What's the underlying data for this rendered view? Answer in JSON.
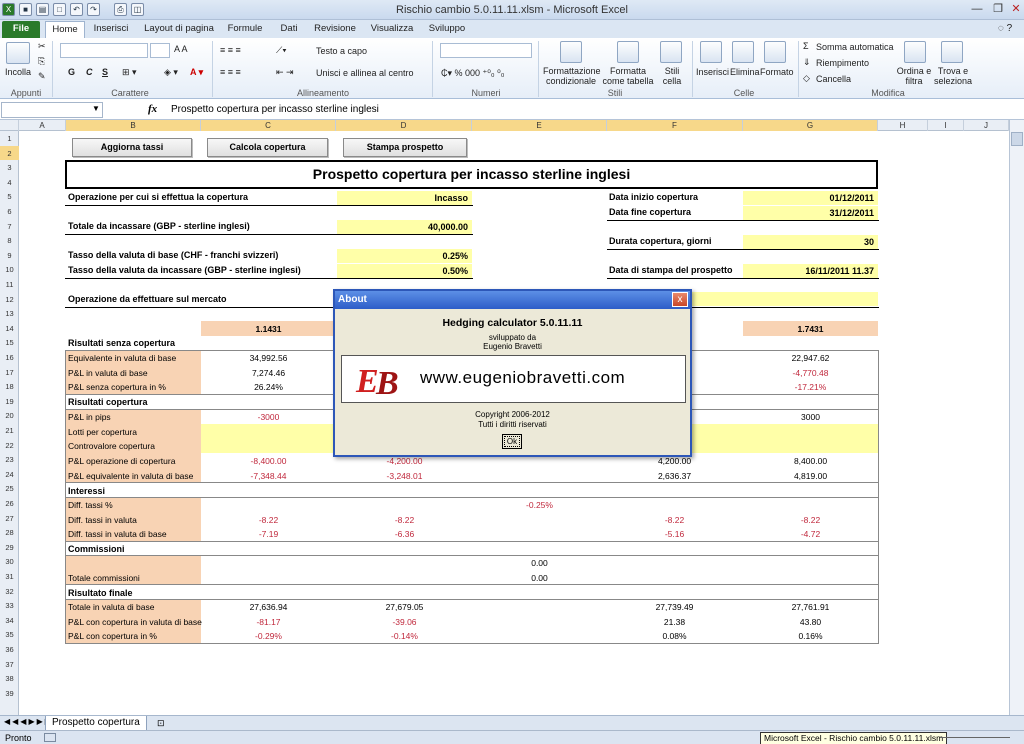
{
  "window": {
    "title": "Rischio cambio 5.0.11.11.xlsm  -  Microsoft Excel"
  },
  "ribbon": {
    "tabs": [
      "File",
      "Home",
      "Inserisci",
      "Layout di pagina",
      "Formule",
      "Dati",
      "Revisione",
      "Visualizza",
      "Sviluppo"
    ],
    "paste": "Incolla",
    "clipboard": "Appunti",
    "font_group": "Carattere",
    "bold": "G",
    "italic": "C",
    "underline": "S",
    "wrap_text": "Testo a capo",
    "merge": "Unisci e allinea al centro",
    "alignment": "Allineamento",
    "number": "Numeri",
    "cond_format": "Formattazione condizionale",
    "format_table": "Formatta come tabella",
    "cell_styles": "Stili cella",
    "styles": "Stili",
    "insert": "Inserisci",
    "delete": "Elimina",
    "format": "Formato",
    "cells": "Celle",
    "autosum": "Somma automatica",
    "fill": "Riempimento",
    "clear": "Cancella",
    "sort_filter": "Ordina e filtra",
    "find": "Trova e seleziona",
    "editing": "Modifica"
  },
  "formula_bar": {
    "fx": "fx",
    "content": "Prospetto copertura per incasso sterline inglesi"
  },
  "columns": [
    "A",
    "B",
    "C",
    "D",
    "E",
    "F",
    "G",
    "H",
    "I",
    "J"
  ],
  "rows": [
    "1",
    "2",
    "3",
    "4",
    "5",
    "6",
    "7",
    "8",
    "9",
    "10",
    "11",
    "12",
    "13",
    "14",
    "15",
    "16",
    "17",
    "18",
    "19",
    "20",
    "21",
    "22",
    "23",
    "24",
    "25",
    "26",
    "27",
    "28",
    "29",
    "30",
    "31",
    "32",
    "33",
    "34",
    "35",
    "36",
    "37",
    "38",
    "39"
  ],
  "sheet": {
    "buttons": {
      "update": "Aggiorna tassi",
      "calc": "Calcola copertura",
      "print": "Stampa prospetto"
    },
    "title": "Prospetto copertura per incasso sterline inglesi",
    "op_label": "Operazione per cui si effettua  la copertura",
    "op_value": "Incasso",
    "total_label": "Totale da incassare (GBP - sterline inglesi)",
    "total_value": "40,000.00",
    "rate_base_label": "Tasso della valuta di base (CHF - franchi svizzeri)",
    "rate_base_value": "0.25%",
    "rate_inc_label": "Tasso della valuta da incassare (GBP - sterline inglesi)",
    "rate_inc_value": "0.50%",
    "start_label": "Data inizio copertura",
    "start_value": "01/12/2011",
    "end_label": "Data fine copertura",
    "end_value": "31/12/2011",
    "days_label": "Durata copertura, giorni",
    "days_value": "30",
    "print_label": "Data di stampa del prospetto",
    "print_value": "16/11/2011 11.37",
    "market_label": "Operazione da effettuare sul mercato",
    "rate_c": "1.1431",
    "rate_g": "1.7431",
    "sec_no_cov": "Risultati senza copertura",
    "eq_label": "Equivalente in valuta di base",
    "eq_c": "34,992.56",
    "eq_g": "22,947.62",
    "pl_base_label": "P&L in valuta di base",
    "pl_base_c": "7,274.46",
    "pl_base_g": "-4,770.48",
    "pl_pct_label": "P&L senza copertura in %",
    "pl_pct_c": "26.24%",
    "pl_pct_g": "-17.21%",
    "sec_cov": "Risultati copertura",
    "pips_label": "P&L in pips",
    "pips_c": "-3000",
    "pips_g": "3000",
    "lots_label": "Lotti per copertura",
    "counter_label": "Controvalore copertura",
    "plop_label": "P&L operazione di copertura",
    "plop_c": "-8,400.00",
    "plop_d": "-4,200.00",
    "plop_f": "4,200.00",
    "plop_g": "8,400.00",
    "pleq_label": "P&L equivalente in valuta di base",
    "pleq_c": "-7,348.44",
    "pleq_d": "-3,248.01",
    "pleq_f": "2,636.37",
    "pleq_g": "4,819.00",
    "sec_int": "Interessi",
    "diff_label": "Diff. tassi %",
    "diff_value": "-0.25%",
    "diffval_label": "Diff. tassi in valuta",
    "diffval_c": "-8.22",
    "diffval_d": "-8.22",
    "diffval_f": "-8.22",
    "diffval_g": "-8.22",
    "diffbase_label": "Diff. tassi in valuta di base",
    "diffbase_c": "-7.19",
    "diffbase_d": "-6.36",
    "diffbase_f": "-5.16",
    "diffbase_g": "-4.72",
    "sec_comm": "Commissioni",
    "comm_value": "0.00",
    "comm_tot_label": "Totale commissioni",
    "comm_tot_value": "0.00",
    "sec_final": "Risultato finale",
    "tot_label": "Totale in valuta di base",
    "tot_c": "27,636.94",
    "tot_d": "27,679.05",
    "tot_f": "27,739.49",
    "tot_g": "27,761.91",
    "plcov_label": "P&L con copertura in valuta di base",
    "plcov_c": "-81.17",
    "plcov_d": "-39.06",
    "plcov_f": "21.38",
    "plcov_g": "43.80",
    "plcovpct_label": "P&L con copertura in %",
    "plcovpct_c": "-0.29%",
    "plcovpct_d": "-0.14%",
    "plcovpct_f": "0.08%",
    "plcovpct_g": "0.16%"
  },
  "dialog": {
    "caption": "About",
    "app": "Hedging calculator 5.0.11.11",
    "dev_by": "sviluppato da",
    "author": "Eugenio Bravetti",
    "url": "www.eugeniobravetti.com",
    "copyright": "Copyright 2006-2012",
    "rights": "Tutti i diritti riservati",
    "ok": "Ok",
    "close": "x"
  },
  "sheet_tab": "Prospetto copertura",
  "status": {
    "ready": "Pronto",
    "taskbar_tip": "Microsoft Excel - Rischio cambio 5.0.11.11.xlsm"
  },
  "colors": {
    "yellow": "#ffffa8",
    "peach": "#f8d3b4",
    "negative": "#c0283c",
    "dialog_blue": "#2d5dc8"
  }
}
